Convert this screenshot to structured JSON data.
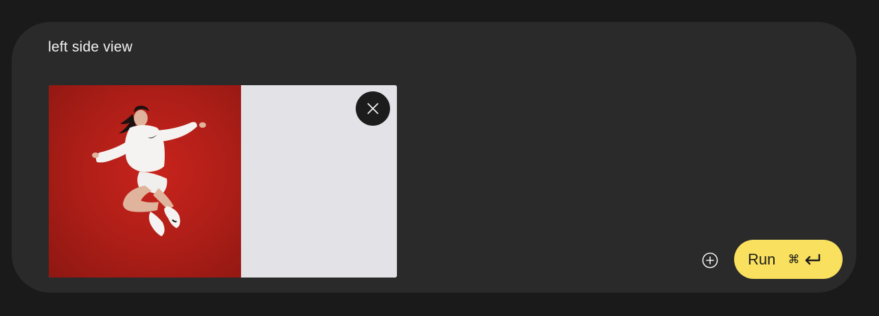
{
  "prompt": {
    "text": "left side view"
  },
  "attachment": {
    "thumbnail_icon": "photo-jumping-woman-red-background",
    "remove_icon": "close-icon"
  },
  "actions": {
    "add_icon": "plus-circle-icon",
    "run_label": "Run",
    "run_shortcut_icons": [
      "command-key-icon",
      "enter-key-icon"
    ]
  },
  "colors": {
    "page_bg": "#1a1a1a",
    "panel_bg": "#2a2a2a",
    "accent": "#f9e05e",
    "photo_bg": "#b11f18",
    "blank_bg": "#e3e2e7"
  }
}
